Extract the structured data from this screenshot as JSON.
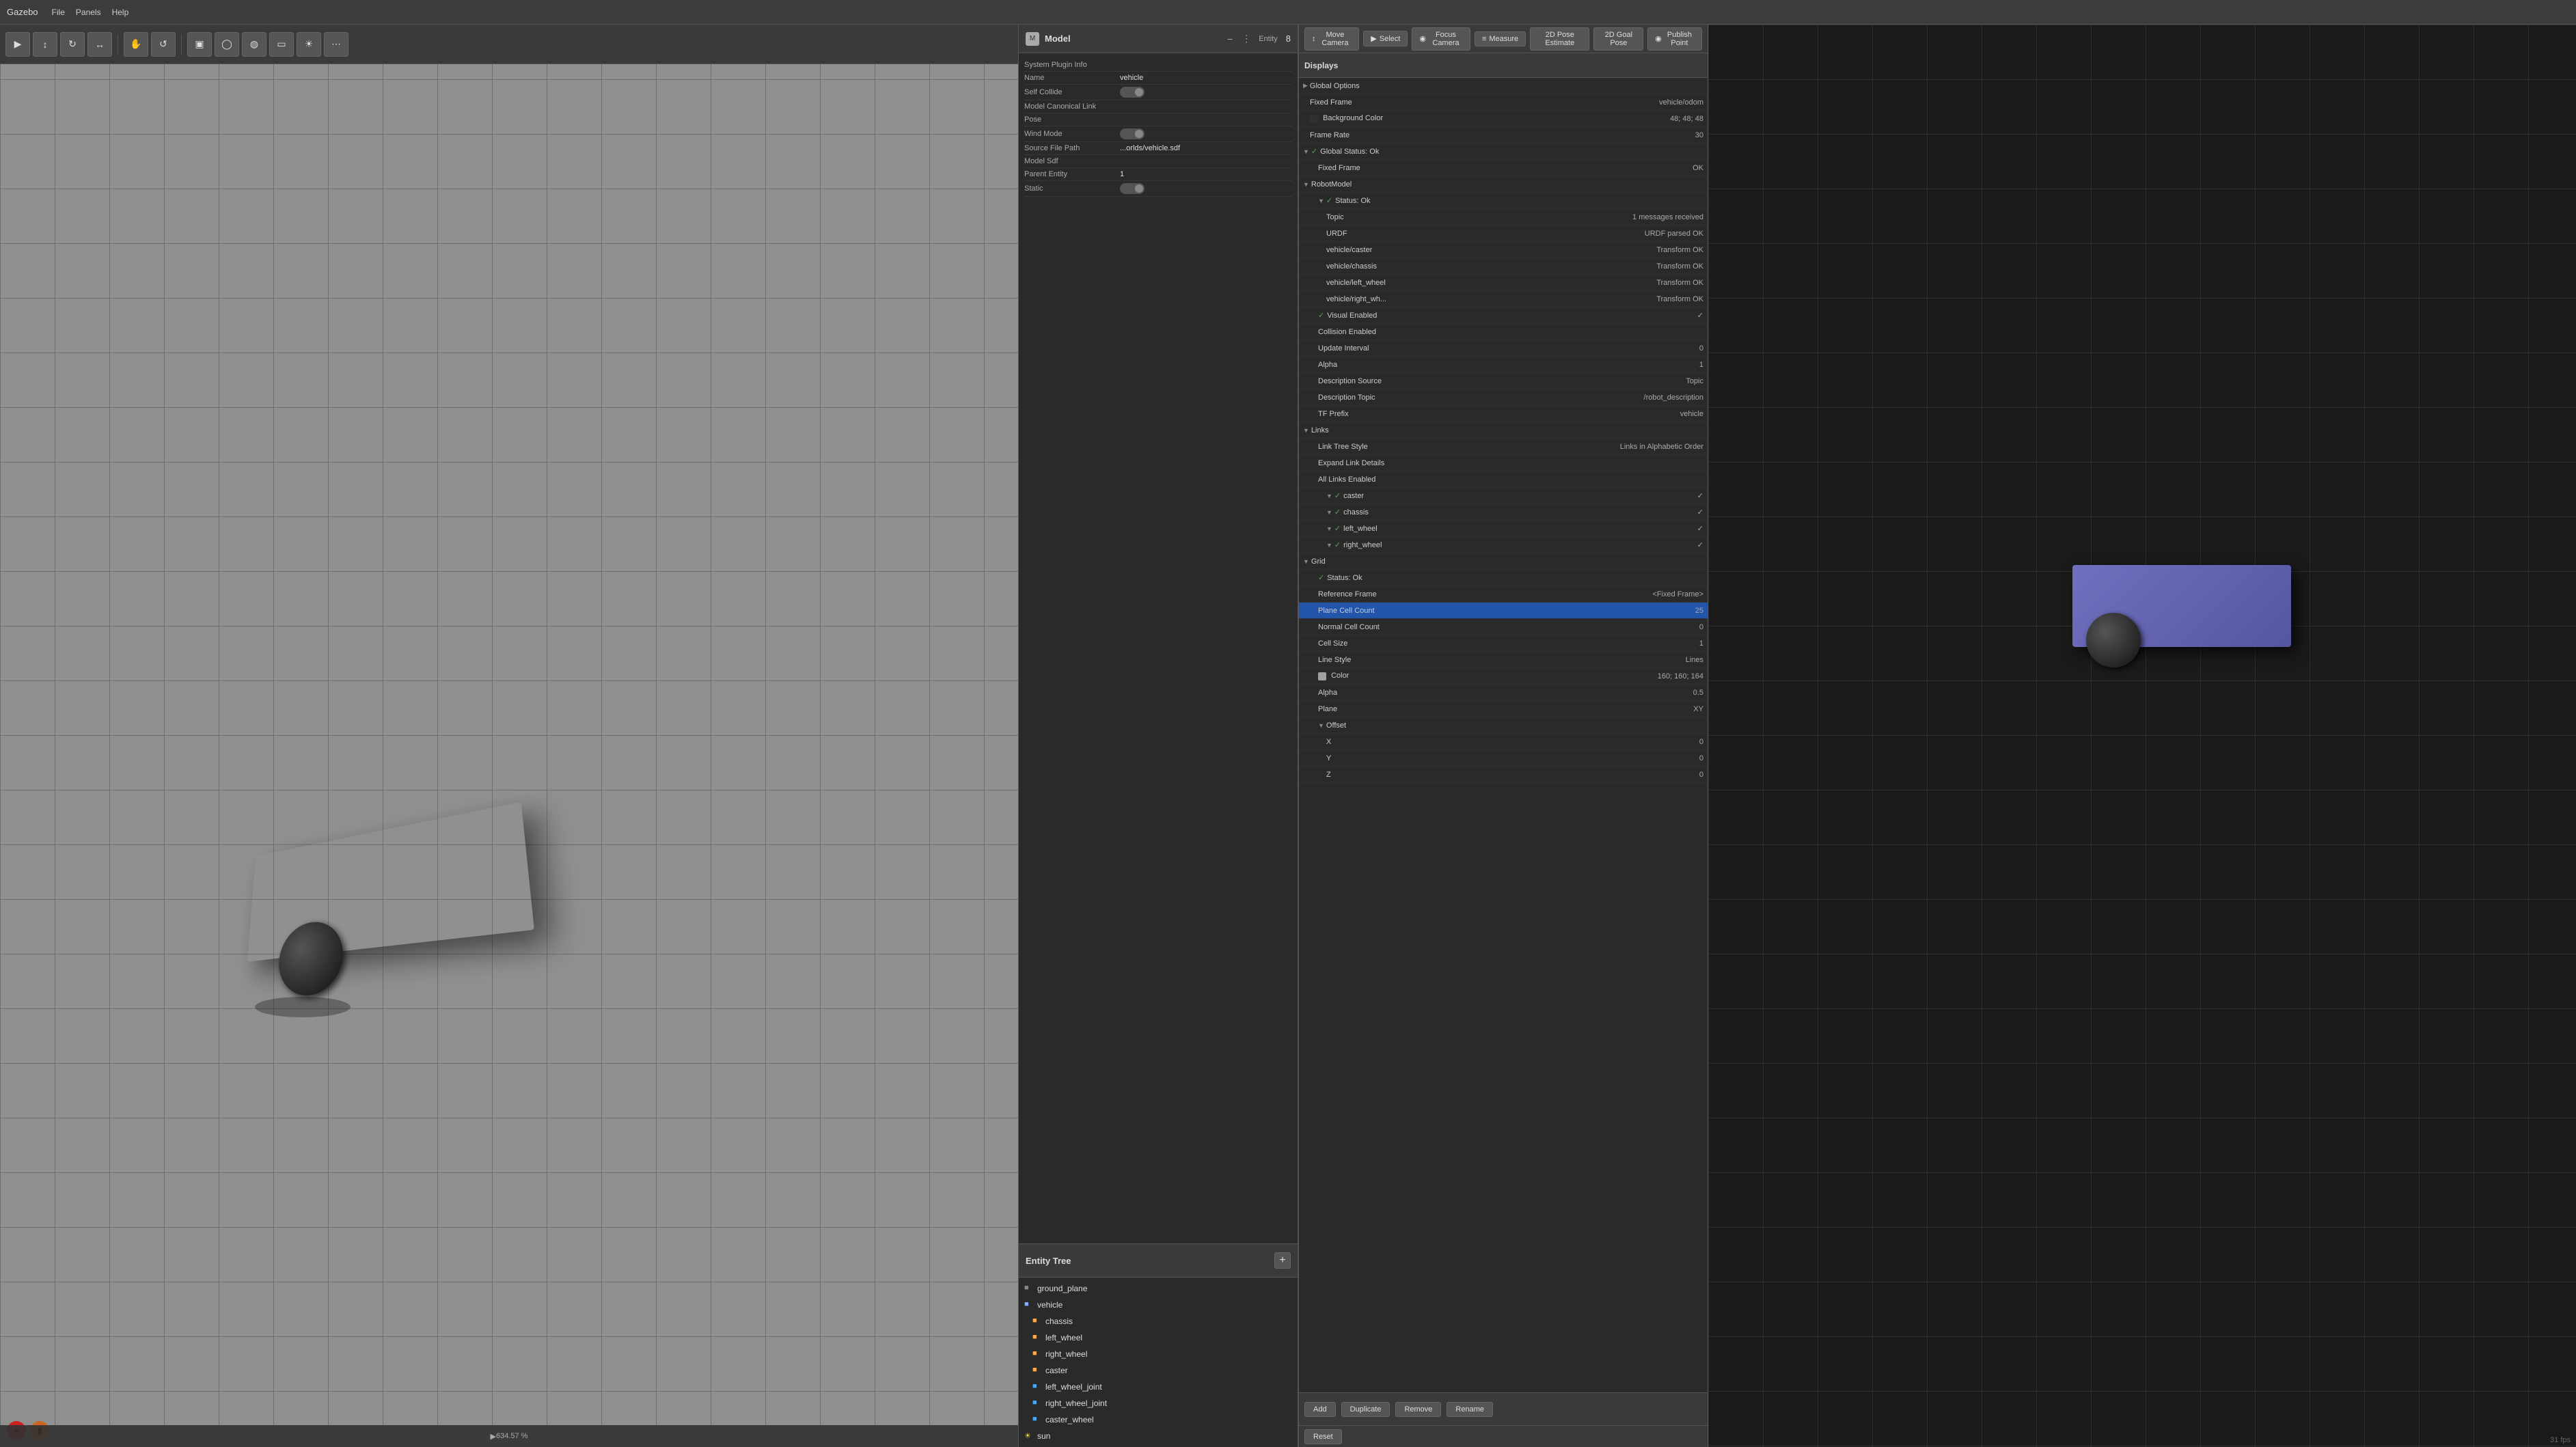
{
  "app": {
    "title": "Gazebo",
    "menu_items": [
      "File",
      "Panels",
      "Help"
    ]
  },
  "toolbar": {
    "buttons": [
      "select",
      "translate",
      "rotate",
      "scale",
      "hand",
      "measure"
    ],
    "right_buttons": [
      "focus-camera",
      "camera",
      "measure",
      "2d-pose",
      "2d-goal",
      "point"
    ]
  },
  "model_panel": {
    "title": "Model",
    "entity_label": "Entity",
    "entity_number": "8",
    "properties": [
      {
        "label": "System Plugin Info",
        "value": ""
      },
      {
        "label": "Name",
        "value": "vehicle"
      },
      {
        "label": "Self Collide",
        "value": "toggle_off"
      },
      {
        "label": "Model Canonical Link",
        "value": ""
      },
      {
        "label": "Pose",
        "value": ""
      },
      {
        "label": "Wind Mode",
        "value": "toggle_off"
      },
      {
        "label": "Source File Path",
        "value": "...orlds/vehicle.sdf"
      },
      {
        "label": "Model Sdf",
        "value": ""
      },
      {
        "label": "Parent Entity",
        "value": "1"
      },
      {
        "label": "Static",
        "value": "toggle_off"
      }
    ]
  },
  "entity_tree": {
    "title": "Entity Tree",
    "items": [
      {
        "label": "ground_plane",
        "level": 0,
        "type": "ground",
        "id": "ground_plane"
      },
      {
        "label": "vehicle",
        "level": 0,
        "type": "vehicle",
        "id": "vehicle",
        "selected": false
      },
      {
        "label": "chassis",
        "level": 1,
        "type": "link",
        "id": "chassis"
      },
      {
        "label": "left_wheel",
        "level": 1,
        "type": "link",
        "id": "left_wheel"
      },
      {
        "label": "right_wheel",
        "level": 1,
        "type": "link",
        "id": "right_wheel"
      },
      {
        "label": "caster",
        "level": 1,
        "type": "link",
        "id": "caster"
      },
      {
        "label": "left_wheel_joint",
        "level": 1,
        "type": "joint",
        "id": "left_wheel_joint"
      },
      {
        "label": "right_wheel_joint",
        "level": 1,
        "type": "joint",
        "id": "right_wheel_joint"
      },
      {
        "label": "caster_wheel",
        "level": 1,
        "type": "joint",
        "id": "caster_wheel"
      },
      {
        "label": "sun",
        "level": 0,
        "type": "sun",
        "id": "sun"
      }
    ]
  },
  "displays_panel": {
    "title": "Displays",
    "rows": [
      {
        "indent": 0,
        "expand": "▶",
        "check": "",
        "label": "Global Options",
        "value": ""
      },
      {
        "indent": 1,
        "expand": "",
        "check": "",
        "label": "Fixed Frame",
        "value": "vehicle/odom"
      },
      {
        "indent": 1,
        "expand": "",
        "check": "color",
        "label": "Background Color",
        "value": "48; 48; 48",
        "color": "#303030"
      },
      {
        "indent": 1,
        "expand": "",
        "check": "",
        "label": "Frame Rate",
        "value": "30"
      },
      {
        "indent": 0,
        "expand": "▼",
        "check": "✓",
        "label": "Global Status: Ok",
        "value": ""
      },
      {
        "indent": 1,
        "expand": "",
        "check": "",
        "label": "Fixed Frame",
        "value": "OK"
      },
      {
        "indent": 0,
        "expand": "▼",
        "check": "",
        "label": "RobotModel",
        "value": ""
      },
      {
        "indent": 1,
        "expand": "▼",
        "check": "✓",
        "label": "Status: Ok",
        "value": ""
      },
      {
        "indent": 2,
        "expand": "",
        "check": "",
        "label": "Topic",
        "value": "1 messages received"
      },
      {
        "indent": 2,
        "expand": "",
        "check": "",
        "label": "URDF",
        "value": "URDF parsed OK"
      },
      {
        "indent": 2,
        "expand": "",
        "check": "",
        "label": "vehicle/caster",
        "value": "Transform OK"
      },
      {
        "indent": 2,
        "expand": "",
        "check": "",
        "label": "vehicle/chassis",
        "value": "Transform OK"
      },
      {
        "indent": 2,
        "expand": "",
        "check": "",
        "label": "vehicle/left_wheel",
        "value": "Transform OK"
      },
      {
        "indent": 2,
        "expand": "",
        "check": "",
        "label": "vehicle/right_wh...",
        "value": "Transform OK"
      },
      {
        "indent": 1,
        "expand": "",
        "check": "✓",
        "label": "Visual Enabled",
        "value": "✓"
      },
      {
        "indent": 1,
        "expand": "",
        "check": "",
        "label": "Collision Enabled",
        "value": ""
      },
      {
        "indent": 1,
        "expand": "",
        "check": "",
        "label": "Update Interval",
        "value": "0"
      },
      {
        "indent": 1,
        "expand": "",
        "check": "",
        "label": "Alpha",
        "value": "1"
      },
      {
        "indent": 1,
        "expand": "",
        "check": "",
        "label": "Description Source",
        "value": "Topic"
      },
      {
        "indent": 1,
        "expand": "",
        "check": "",
        "label": "Description Topic",
        "value": "/robot_description"
      },
      {
        "indent": 1,
        "expand": "",
        "check": "",
        "label": "TF Prefix",
        "value": "vehicle"
      },
      {
        "indent": 0,
        "expand": "▼",
        "check": "",
        "label": "Links",
        "value": ""
      },
      {
        "indent": 1,
        "expand": "",
        "check": "",
        "label": "Link Tree Style",
        "value": "Links in Alphabetic Order"
      },
      {
        "indent": 1,
        "expand": "",
        "check": "",
        "label": "Expand Link Details",
        "value": ""
      },
      {
        "indent": 1,
        "expand": "",
        "check": "",
        "label": "All Links Enabled",
        "value": ""
      },
      {
        "indent": 2,
        "expand": "▼",
        "check": "✓",
        "label": "caster",
        "value": "✓"
      },
      {
        "indent": 2,
        "expand": "▼",
        "check": "✓",
        "label": "chassis",
        "value": "✓"
      },
      {
        "indent": 2,
        "expand": "▼",
        "check": "✓",
        "label": "left_wheel",
        "value": "✓"
      },
      {
        "indent": 2,
        "expand": "▼",
        "check": "✓",
        "label": "right_wheel",
        "value": "✓"
      },
      {
        "indent": 0,
        "expand": "▼",
        "check": "",
        "label": "Grid",
        "value": ""
      },
      {
        "indent": 1,
        "expand": "",
        "check": "✓",
        "label": "Status: Ok",
        "value": ""
      },
      {
        "indent": 1,
        "expand": "",
        "check": "",
        "label": "Reference Frame",
        "value": "<Fixed Frame>"
      },
      {
        "indent": 1,
        "expand": "",
        "check": "selected",
        "label": "Plane Cell Count",
        "value": "25",
        "selected": true
      },
      {
        "indent": 1,
        "expand": "",
        "check": "",
        "label": "Normal Cell Count",
        "value": "0"
      },
      {
        "indent": 1,
        "expand": "",
        "check": "",
        "label": "Cell Size",
        "value": "1"
      },
      {
        "indent": 1,
        "expand": "",
        "check": "",
        "label": "Line Style",
        "value": "Lines"
      },
      {
        "indent": 1,
        "expand": "",
        "check": "color",
        "label": "Color",
        "value": "160; 160; 164",
        "color": "#a0a0a4"
      },
      {
        "indent": 1,
        "expand": "",
        "check": "",
        "label": "Alpha",
        "value": "0.5"
      },
      {
        "indent": 1,
        "expand": "",
        "check": "",
        "label": "Plane",
        "value": "XY"
      },
      {
        "indent": 1,
        "expand": "▼",
        "check": "",
        "label": "Offset",
        "value": ""
      },
      {
        "indent": 2,
        "expand": "",
        "check": "",
        "label": "X",
        "value": "0"
      },
      {
        "indent": 2,
        "expand": "",
        "check": "",
        "label": "Y",
        "value": "0"
      },
      {
        "indent": 2,
        "expand": "",
        "check": "",
        "label": "Z",
        "value": "0"
      }
    ],
    "footer_buttons": [
      "Add",
      "Duplicate",
      "Remove",
      "Rename"
    ],
    "reset_label": "Reset"
  },
  "top_bar": {
    "buttons": [
      {
        "label": "Move Camera",
        "icon": "move"
      },
      {
        "label": "Select",
        "icon": "select"
      },
      {
        "label": "Focus Camera",
        "icon": "focus"
      },
      {
        "label": "Measure",
        "icon": "measure"
      },
      {
        "label": "2D Pose Estimate",
        "icon": "pose"
      },
      {
        "label": "2D Goal Pose",
        "icon": "goal"
      },
      {
        "label": "Publish Point",
        "icon": "point"
      }
    ]
  },
  "viewport_left": {
    "zoom": "634.57 %"
  },
  "viewport_right": {
    "fps": "31 fps"
  },
  "record": {
    "red_btn": "record",
    "orange_btn": "stop"
  }
}
